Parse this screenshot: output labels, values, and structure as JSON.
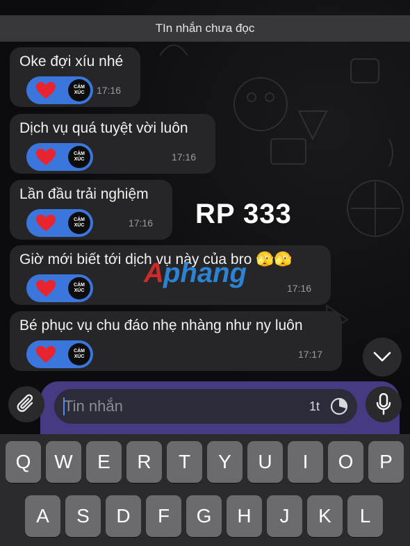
{
  "header": {
    "unread_label": "TIn nhắn chưa đọc"
  },
  "messages": [
    {
      "text": "Oke đợi xíu nhé",
      "time": "17:16",
      "reaction_badge": [
        "CẢM",
        "XÚC"
      ]
    },
    {
      "text": "Dịch vụ quá tuyệt vời luôn",
      "time": "17:16",
      "reaction_badge": [
        "CẢM",
        "XÚC"
      ]
    },
    {
      "text": "Lần đầu trải nghiệm",
      "time": "17:16",
      "reaction_badge": [
        "CẢM",
        "XÚC"
      ]
    },
    {
      "text": "Giờ mới biết tới dịch vụ này của bro 🫣🫣",
      "time": "17:16",
      "reaction_badge": [
        "CẢM",
        "XÚC"
      ]
    },
    {
      "text": "Bé phục vụ chu đáo nhẹ nhàng như ny luôn",
      "time": "17:17",
      "reaction_badge": [
        "CẢM",
        "XÚC"
      ]
    }
  ],
  "overlay": {
    "caption": "RP 333",
    "watermark": "Aphang"
  },
  "composer": {
    "placeholder": "Tin nhắn",
    "timer_label": "1t"
  },
  "icons": {
    "attach": "paperclip-icon",
    "mic": "microphone-icon",
    "scroll": "chevron-down-icon",
    "timer": "timer-icon",
    "heart": "heart-icon"
  },
  "colors": {
    "reaction_bg": "#3b76dd",
    "heart": "#e8242f",
    "composer": "#463a83",
    "watermark_red": "#e22b2b",
    "watermark_blue": "#2d8ce6"
  },
  "keyboard": {
    "row1": [
      "Q",
      "W",
      "E",
      "R",
      "T",
      "Y",
      "U",
      "I",
      "O",
      "P"
    ],
    "row2": [
      "A",
      "S",
      "D",
      "F",
      "G",
      "H",
      "J",
      "K",
      "L"
    ]
  }
}
